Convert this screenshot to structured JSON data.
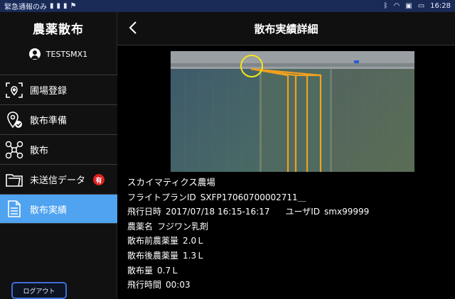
{
  "status_bar": {
    "left_text": "緊急通報のみ",
    "time": "16:28"
  },
  "sidebar": {
    "app_title": "農薬散布",
    "username": "TESTSMX1",
    "items": [
      {
        "label": "圃場登録",
        "icon": "field-registration-icon"
      },
      {
        "label": "散布準備",
        "icon": "location-check-icon"
      },
      {
        "label": "散布",
        "icon": "drone-icon"
      },
      {
        "label": "未送信データ",
        "icon": "folder-icon",
        "badge": "有"
      },
      {
        "label": "散布実績",
        "icon": "document-icon"
      }
    ],
    "logout_label": "ログアウト"
  },
  "header": {
    "title": "散布実績詳細"
  },
  "detail": {
    "farm_name": "スカイマティクス農場",
    "flight_plan_label": "フライトプランID",
    "flight_plan_value": "SXFP17060700002711＿",
    "flight_datetime_label": "飛行日時",
    "flight_datetime_value": "2017/07/18 16:15-16:17",
    "user_id_label": "ユーザID",
    "user_id_value": "smx99999",
    "pesticide_label": "農薬名",
    "pesticide_value": "フジワン乳剤",
    "before_amount_label": "散布前農薬量",
    "before_amount_value": "2.0Ｌ",
    "after_amount_label": "散布後農薬量",
    "after_amount_value": "1.3Ｌ",
    "spray_amount_label": "散布量",
    "spray_amount_value": "0.7Ｌ",
    "flight_time_label": "飛行時間",
    "flight_time_value": "00:03"
  },
  "colors": {
    "accent": "#4fa3f0",
    "badge": "#e0201e",
    "flight_path": "#f0a020",
    "marker": "#f3e61a"
  }
}
